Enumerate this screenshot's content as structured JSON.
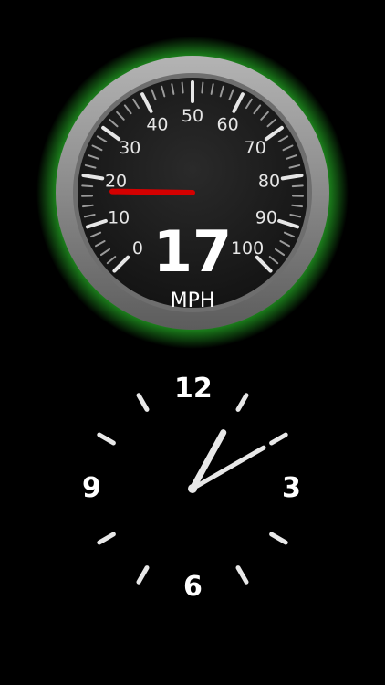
{
  "speedometer": {
    "speed": "17",
    "unit": "MPH",
    "scale_labels": [
      "0",
      "10",
      "20",
      "30",
      "40",
      "50",
      "60",
      "70",
      "80",
      "90",
      "100"
    ],
    "needle_value": 17,
    "glow_color": "#1f8f1f",
    "needle_color": "#d40000"
  },
  "clock": {
    "numerals": [
      "12",
      "3",
      "6",
      "9"
    ],
    "hour_hand_value": 0.08,
    "minute_hand_value": 0.167
  }
}
